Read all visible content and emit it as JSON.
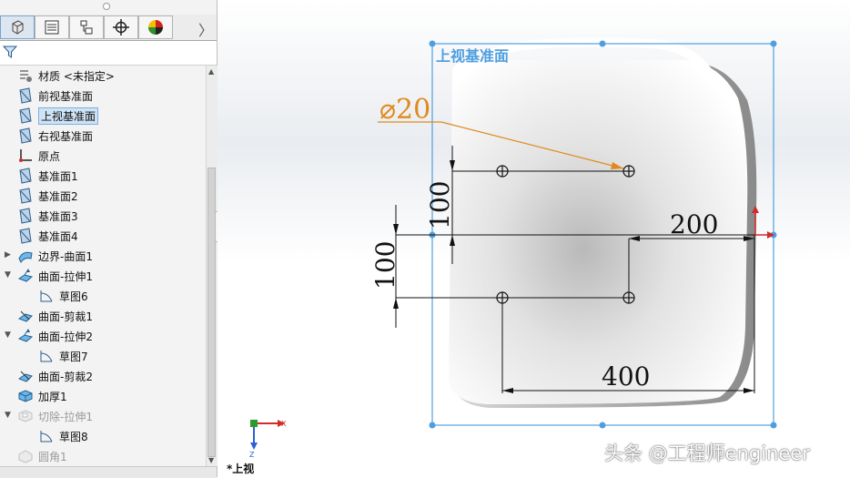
{
  "panel": {
    "tabs": [
      {
        "name": "feature-manager-tab",
        "icon": "part-tree-icon",
        "active": true
      },
      {
        "name": "property-manager-tab",
        "icon": "property-list-icon"
      },
      {
        "name": "configuration-manager-tab",
        "icon": "configuration-icon"
      },
      {
        "name": "dimxpert-tab",
        "icon": "crosshair-icon"
      },
      {
        "name": "display-manager-tab",
        "icon": "color-wheel-icon"
      }
    ],
    "more_glyph": "〉",
    "tree_items": [
      {
        "label": "材质 <未指定>",
        "icon": "material-icon",
        "indent": 1,
        "expander": ""
      },
      {
        "label": "前视基准面",
        "icon": "plane-icon",
        "indent": 1,
        "expander": ""
      },
      {
        "label": "上视基准面",
        "icon": "plane-icon",
        "indent": 1,
        "expander": "",
        "selected": true
      },
      {
        "label": "右视基准面",
        "icon": "plane-icon",
        "indent": 1,
        "expander": ""
      },
      {
        "label": "原点",
        "icon": "origin-icon",
        "indent": 1,
        "expander": ""
      },
      {
        "label": "基准面1",
        "icon": "plane-icon",
        "indent": 1,
        "expander": ""
      },
      {
        "label": "基准面2",
        "icon": "plane-icon",
        "indent": 1,
        "expander": ""
      },
      {
        "label": "基准面3",
        "icon": "plane-icon",
        "indent": 1,
        "expander": ""
      },
      {
        "label": "基准面4",
        "icon": "plane-icon",
        "indent": 1,
        "expander": ""
      },
      {
        "label": "边界-曲面1",
        "icon": "boundary-surface-icon",
        "indent": 1,
        "expander": "▶"
      },
      {
        "label": "曲面-拉伸1",
        "icon": "extrude-surface-icon",
        "indent": 1,
        "expander": "▼"
      },
      {
        "label": "草图6",
        "icon": "sketch-icon",
        "indent": 2,
        "expander": ""
      },
      {
        "label": "曲面-剪裁1",
        "icon": "trim-surface-icon",
        "indent": 1,
        "expander": ""
      },
      {
        "label": "曲面-拉伸2",
        "icon": "extrude-surface-icon",
        "indent": 1,
        "expander": "▼"
      },
      {
        "label": "草图7",
        "icon": "sketch-icon",
        "indent": 2,
        "expander": ""
      },
      {
        "label": "曲面-剪裁2",
        "icon": "trim-surface-icon",
        "indent": 1,
        "expander": ""
      },
      {
        "label": "加厚1",
        "icon": "thicken-icon",
        "indent": 1,
        "expander": ""
      },
      {
        "label": "切除-拉伸1",
        "icon": "cut-extrude-icon",
        "indent": 1,
        "expander": "▼",
        "dim": true
      },
      {
        "label": "草图8",
        "icon": "sketch-icon",
        "indent": 2,
        "expander": ""
      },
      {
        "label": "圆角1",
        "icon": "fillet-icon",
        "indent": 1,
        "expander": "",
        "dim": true
      }
    ]
  },
  "viewport": {
    "plane_label": "上视基准面",
    "dims": {
      "diameter": "⌀20",
      "vertical_top": "100",
      "vertical_left": "100",
      "horizontal_top": "200",
      "horizontal_bottom": "400"
    },
    "triad": {
      "x": "X",
      "z": "Z"
    },
    "view_name": "*上视",
    "watermark": "头条 @工程师engineer"
  },
  "colors": {
    "plane_blue": "#4f9fe0",
    "dimension_orange": "#e08a1e",
    "selection_bg": "#cfe3f7"
  }
}
